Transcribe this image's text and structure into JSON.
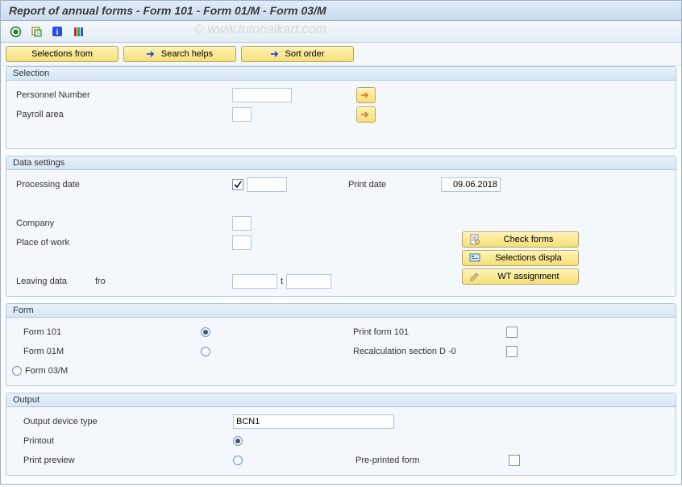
{
  "title": "Report of annual forms -  Form 101  -  Form 01/M  -  Form 03/M",
  "watermark": "© www.tutorialkart.com",
  "actions": {
    "selections_from": "Selections from",
    "search_helps": "Search helps",
    "sort_order": "Sort order"
  },
  "groups": {
    "selection": {
      "title": "Selection",
      "personnel_number": "Personnel Number",
      "payroll_area": "Payroll area"
    },
    "data_settings": {
      "title": "Data settings",
      "processing_date": "Processing date",
      "print_date": "Print date",
      "print_date_value": "09.06.2018",
      "company": "Company",
      "place_of_work": "Place of work",
      "leaving_data": "Leaving data",
      "fro": "fro",
      "t": "t",
      "buttons": {
        "check_forms": "Check forms",
        "selections_displa": "Selections displa",
        "wt_assignment": "WT assignment"
      }
    },
    "form": {
      "title": "Form",
      "form101": "Form 101",
      "form01m": "Form 01M",
      "form03m": "Form 03/M",
      "print_form101": "Print form 101",
      "recalc": "Recalculation section D -0"
    },
    "output": {
      "title": "Output",
      "device_type": "Output device type",
      "device_value": "BCN1",
      "printout": "Printout",
      "preview": "Print preview",
      "preprinted": "Pre-printed form"
    }
  }
}
